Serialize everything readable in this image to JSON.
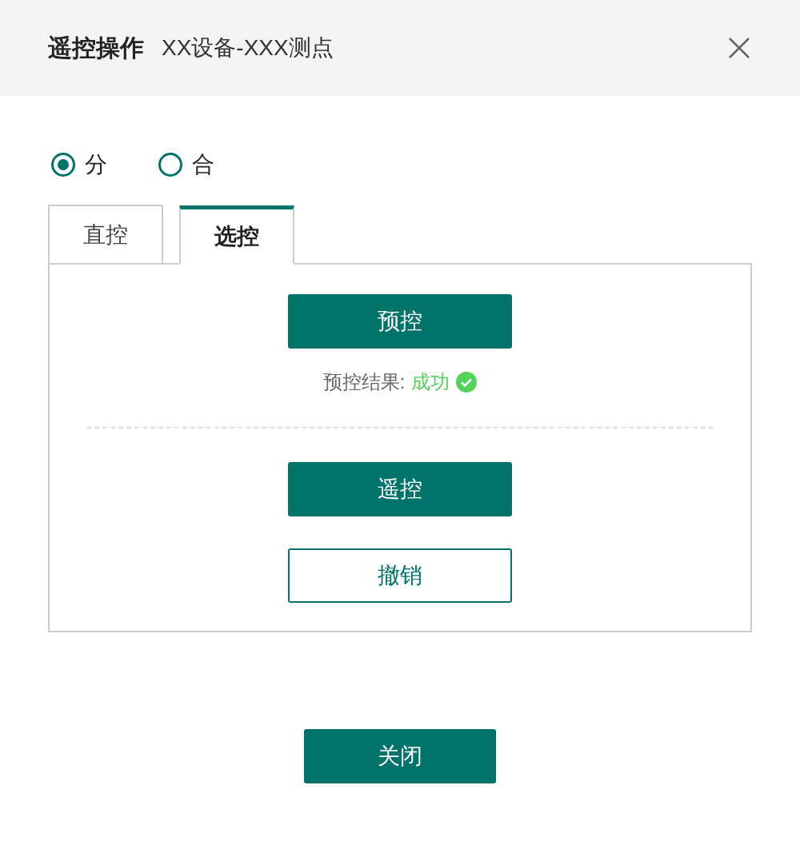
{
  "header": {
    "title": "遥控操作",
    "subtitle": "XX设备-XXX测点"
  },
  "options": [
    {
      "label": "分",
      "selected": true
    },
    {
      "label": "合",
      "selected": false
    }
  ],
  "tabs": [
    {
      "label": "直控",
      "selected": false
    },
    {
      "label": "选控",
      "selected": true
    }
  ],
  "panel": {
    "precontrol_button": "预控",
    "result": {
      "label": "预控结果:",
      "value": "成功",
      "success": true
    },
    "buttons": [
      {
        "label": "遥控",
        "kind": "primary"
      },
      {
        "label": "撤销",
        "kind": "outline"
      }
    ]
  },
  "footer_button": "关闭"
}
